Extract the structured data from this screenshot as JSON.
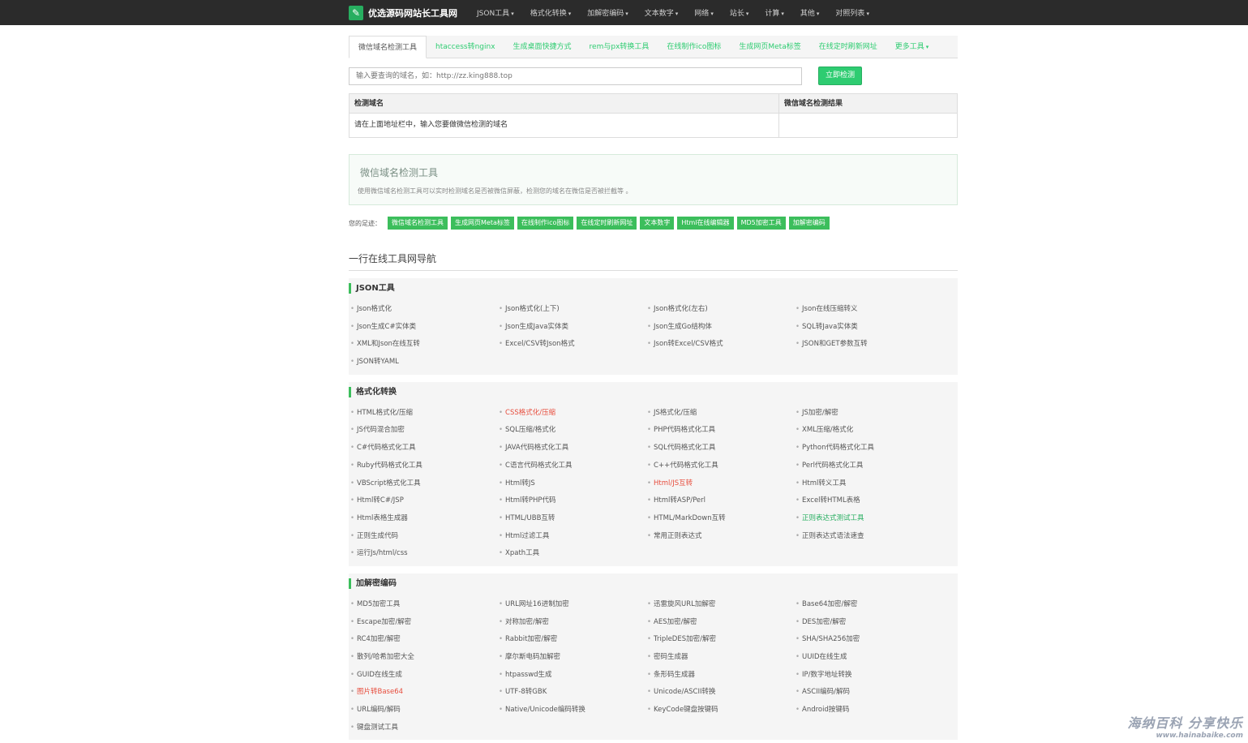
{
  "navbar": {
    "brand": "优选源码网站长工具网",
    "items": [
      {
        "label": "JSON工具"
      },
      {
        "label": "格式化转换"
      },
      {
        "label": "加解密编码"
      },
      {
        "label": "文本数字"
      },
      {
        "label": "网络"
      },
      {
        "label": "站长"
      },
      {
        "label": "计算"
      },
      {
        "label": "其他"
      },
      {
        "label": "对照列表"
      }
    ]
  },
  "tabs": [
    {
      "label": "微信域名检测工具",
      "active": true
    },
    {
      "label": "htaccess转nginx"
    },
    {
      "label": "生成桌面快捷方式"
    },
    {
      "label": "rem与px转换工具"
    },
    {
      "label": "在线制作ico图标"
    },
    {
      "label": "生成网页Meta标签"
    },
    {
      "label": "在线定时刷新网址"
    },
    {
      "label": "更多工具"
    }
  ],
  "query": {
    "placeholder": "输入要查询的域名，如：http://zz.king888.top",
    "button": "立即检测"
  },
  "result_table": {
    "col1": "检测域名",
    "col2": "微信域名检测结果",
    "row": "请在上面地址栏中，输入您要做微信检测的域名",
    "result": ""
  },
  "info": {
    "title": "微信域名检测工具",
    "desc": "使用微信域名检测工具可以实时检测域名是否被微信屏蔽，检测您的域名在微信是否被拦截等 。"
  },
  "footprints": {
    "label": "您的足迹：",
    "tags": [
      "微信域名检测工具",
      "生成网页Meta标签",
      "在线制作ico图标",
      "在线定时刷新网址",
      "文本数字",
      "Html在线编辑器",
      "MD5加密工具",
      "加解密编码"
    ]
  },
  "nav_title": "一行在线工具网导航",
  "sections": [
    {
      "title": "JSON工具",
      "items": [
        {
          "label": "Json格式化"
        },
        {
          "label": "Json格式化(上下)"
        },
        {
          "label": "Json格式化(左右)"
        },
        {
          "label": "Json在线压缩转义"
        },
        {
          "label": "Json生成C#实体类"
        },
        {
          "label": "Json生成Java实体类"
        },
        {
          "label": "Json生成Go结构体"
        },
        {
          "label": "SQL转Java实体类"
        },
        {
          "label": "XML和Json在线互转"
        },
        {
          "label": "Excel/CSV转Json格式"
        },
        {
          "label": "Json转Excel/CSV格式"
        },
        {
          "label": "JSON和GET参数互转"
        },
        {
          "label": "JSON转YAML"
        }
      ]
    },
    {
      "title": "格式化转换",
      "items": [
        {
          "label": "HTML格式化/压缩"
        },
        {
          "label": "CSS格式化/压缩",
          "color": "red"
        },
        {
          "label": "JS格式化/压缩"
        },
        {
          "label": "JS加密/解密"
        },
        {
          "label": "JS代码混合加密"
        },
        {
          "label": "SQL压缩/格式化"
        },
        {
          "label": "PHP代码格式化工具"
        },
        {
          "label": "XML压缩/格式化"
        },
        {
          "label": "C#代码格式化工具"
        },
        {
          "label": "JAVA代码格式化工具"
        },
        {
          "label": "SQL代码格式化工具"
        },
        {
          "label": "Python代码格式化工具"
        },
        {
          "label": "Ruby代码格式化工具"
        },
        {
          "label": "C语言代码格式化工具"
        },
        {
          "label": "C++代码格式化工具"
        },
        {
          "label": "Perl代码格式化工具"
        },
        {
          "label": "VBScript格式化工具"
        },
        {
          "label": "Html转JS"
        },
        {
          "label": "Html/JS互转",
          "color": "red"
        },
        {
          "label": "Html转义工具"
        },
        {
          "label": "Html转C#/JSP"
        },
        {
          "label": "Html转PHP代码"
        },
        {
          "label": "Html转ASP/Perl"
        },
        {
          "label": "Excel转HTML表格"
        },
        {
          "label": "Html表格生成器"
        },
        {
          "label": "HTML/UBB互转"
        },
        {
          "label": "HTML/MarkDown互转"
        },
        {
          "label": "正则表达式测试工具",
          "color": "green"
        },
        {
          "label": "正则生成代码"
        },
        {
          "label": "Html过滤工具"
        },
        {
          "label": "常用正则表达式"
        },
        {
          "label": "正则表达式语法速查"
        },
        {
          "label": "运行Js/html/css"
        },
        {
          "label": "Xpath工具"
        }
      ]
    },
    {
      "title": "加解密编码",
      "items": [
        {
          "label": "MD5加密工具"
        },
        {
          "label": "URL网址16进制加密"
        },
        {
          "label": "迅雷旋风URL加解密"
        },
        {
          "label": "Base64加密/解密"
        },
        {
          "label": "Escape加密/解密"
        },
        {
          "label": "对称加密/解密"
        },
        {
          "label": "AES加密/解密"
        },
        {
          "label": "DES加密/解密"
        },
        {
          "label": "RC4加密/解密"
        },
        {
          "label": "Rabbit加密/解密"
        },
        {
          "label": "TripleDES加密/解密"
        },
        {
          "label": "SHA/SHA256加密"
        },
        {
          "label": "散列/哈希加密大全"
        },
        {
          "label": "摩尔斯电码加解密"
        },
        {
          "label": "密码生成器"
        },
        {
          "label": "UUID在线生成"
        },
        {
          "label": "GUID在线生成"
        },
        {
          "label": "htpasswd生成"
        },
        {
          "label": "条形码生成器"
        },
        {
          "label": "IP/数字地址转换"
        },
        {
          "label": "图片转Base64",
          "color": "red"
        },
        {
          "label": "UTF-8转GBK"
        },
        {
          "label": "Unicode/ASCII转换"
        },
        {
          "label": "ASCII编码/解码"
        },
        {
          "label": "URL编码/解码"
        },
        {
          "label": "Native/Unicode编码转换"
        },
        {
          "label": "KeyCode键盘按键码"
        },
        {
          "label": "Android按键码"
        },
        {
          "label": "键盘测试工具"
        }
      ]
    }
  ],
  "watermark": {
    "line1": "海纳百科 分享快乐",
    "line2": "www.hainabaike.com"
  }
}
